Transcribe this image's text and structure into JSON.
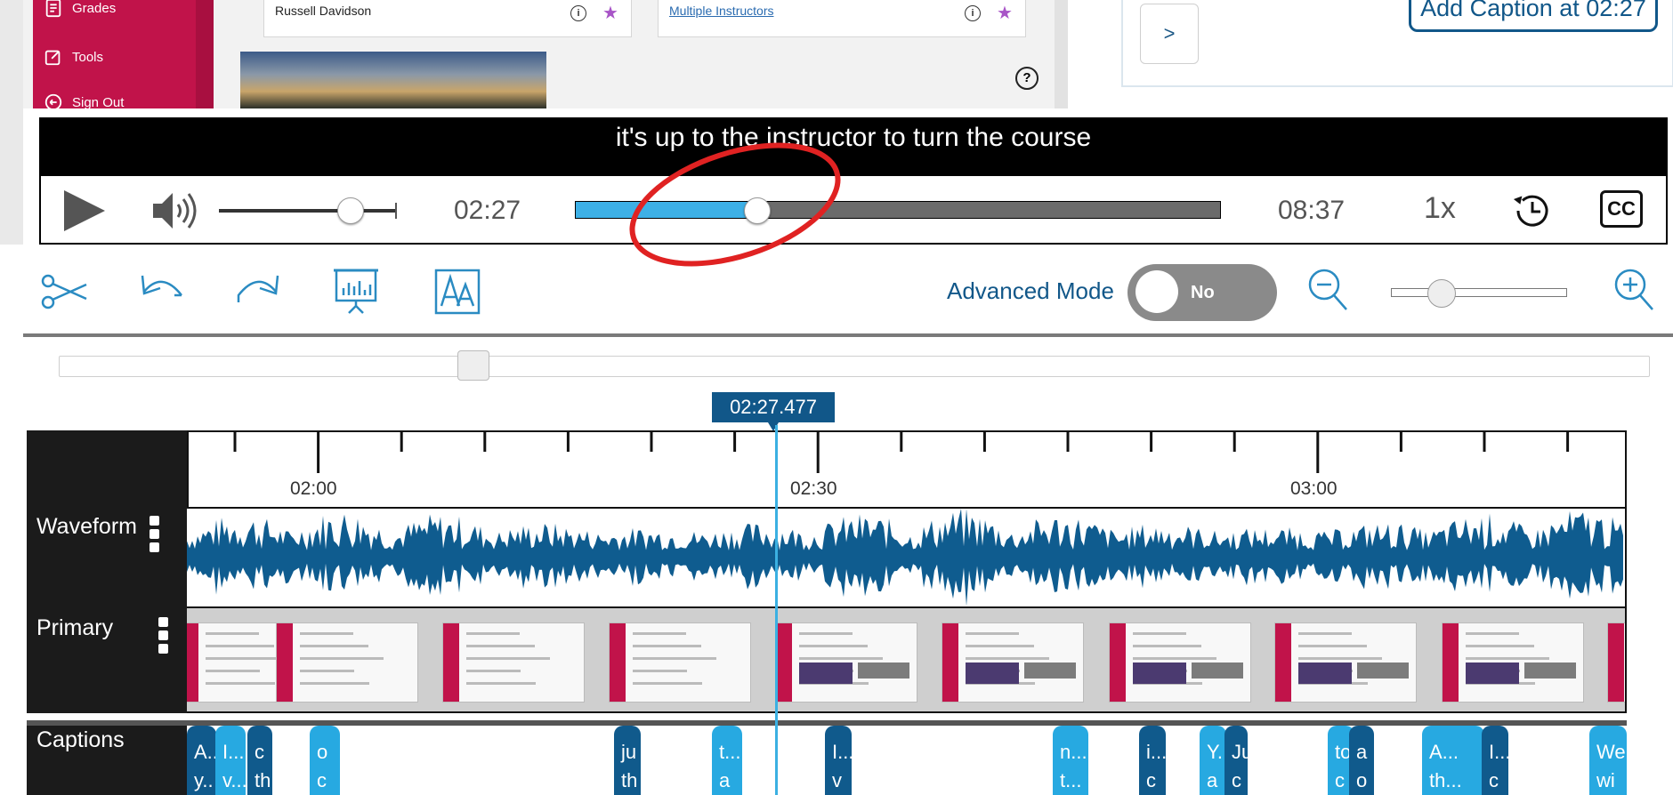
{
  "lms": {
    "nav": [
      {
        "label": "Grades",
        "icon": "grades-icon"
      },
      {
        "label": "Tools",
        "icon": "tools-icon"
      },
      {
        "label": "Sign Out",
        "icon": "sign-out-icon"
      }
    ],
    "card1_name": "Russell Davidson",
    "card2_name": "Multiple Instructors",
    "help": "?"
  },
  "caption_panel": {
    "next_label": ">",
    "add_caption_label": "Add Caption at 02:27"
  },
  "player": {
    "subtitle": "it's up to the instructor to turn the course",
    "current_time": "02:27",
    "duration": "08:37",
    "speed": "1x",
    "cc_label": "CC",
    "volume_fraction": 0.75,
    "progress_fraction": 0.29
  },
  "toolbar": {
    "tools": [
      "scissors-icon",
      "undo-icon",
      "redo-icon",
      "presentation-icon",
      "font-icon"
    ],
    "advanced_mode_label": "Advanced Mode",
    "advanced_mode_value": "No"
  },
  "timeline": {
    "playhead_time": "02:27.477",
    "ruler_labels": [
      "02:00",
      "02:30",
      "03:00"
    ],
    "tracks": {
      "waveform": "Waveform",
      "primary": "Primary",
      "captions": "Captions"
    },
    "captions": [
      {
        "text": "A..\ny..",
        "tone": "dark"
      },
      {
        "text": "I...\nv...",
        "tone": "light"
      },
      {
        "text": "c\nth",
        "tone": "dark"
      },
      {
        "text": "o\nc",
        "tone": "light"
      },
      {
        "text": "ju\nth",
        "tone": "dark"
      },
      {
        "text": "t...\na",
        "tone": "light"
      },
      {
        "text": "I...\nv",
        "tone": "dark"
      },
      {
        "text": "n...\nt...",
        "tone": "light"
      },
      {
        "text": "i...\nc",
        "tone": "dark"
      },
      {
        "text": "Y.\na",
        "tone": "light"
      },
      {
        "text": "Ju\nc",
        "tone": "dark"
      },
      {
        "text": "to\nc",
        "tone": "light"
      },
      {
        "text": "a\no",
        "tone": "dark"
      },
      {
        "text": "A...\nth...",
        "tone": "light"
      },
      {
        "text": "I...\nc",
        "tone": "dark"
      },
      {
        "text": "We\nwi",
        "tone": "light"
      }
    ]
  },
  "colors": {
    "accent": "#115789",
    "lms_nav": "#c1134a",
    "progress": "#3db0e6",
    "caption_light": "#27a9e1",
    "caption_dark": "#105a8c",
    "waveform": "#0f5c8f"
  }
}
